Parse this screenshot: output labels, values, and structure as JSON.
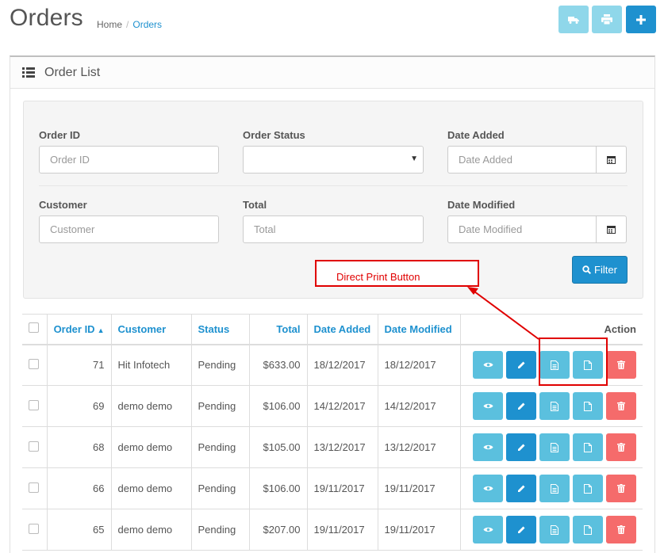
{
  "header": {
    "title": "Orders",
    "breadcrumb": [
      "Home",
      "Orders"
    ],
    "buttons": {
      "ship_icon": "truck-icon",
      "print_icon": "print-icon",
      "add_icon": "plus-icon"
    }
  },
  "panel": {
    "title": "Order List",
    "filters": {
      "order_id": {
        "label": "Order ID",
        "placeholder": "Order ID"
      },
      "order_status": {
        "label": "Order Status",
        "value": ""
      },
      "date_added": {
        "label": "Date Added",
        "placeholder": "Date Added"
      },
      "customer": {
        "label": "Customer",
        "placeholder": "Customer"
      },
      "total": {
        "label": "Total",
        "placeholder": "Total"
      },
      "date_modified": {
        "label": "Date Modified",
        "placeholder": "Date Modified"
      },
      "filter_button": "Filter"
    }
  },
  "annotation": {
    "label": "Direct Print Button",
    "color": "#e00000"
  },
  "table": {
    "columns": [
      "Order ID",
      "Customer",
      "Status",
      "Total",
      "Date Added",
      "Date Modified",
      "Action"
    ],
    "rows": [
      {
        "id": "71",
        "customer": "Hit Infotech",
        "status": "Pending",
        "total": "$633.00",
        "added": "18/12/2017",
        "modified": "18/12/2017"
      },
      {
        "id": "69",
        "customer": "demo demo",
        "status": "Pending",
        "total": "$106.00",
        "added": "14/12/2017",
        "modified": "14/12/2017"
      },
      {
        "id": "68",
        "customer": "demo demo",
        "status": "Pending",
        "total": "$105.00",
        "added": "13/12/2017",
        "modified": "13/12/2017"
      },
      {
        "id": "66",
        "customer": "demo demo",
        "status": "Pending",
        "total": "$106.00",
        "added": "19/11/2017",
        "modified": "19/11/2017"
      },
      {
        "id": "65",
        "customer": "demo demo",
        "status": "Pending",
        "total": "$207.00",
        "added": "19/11/2017",
        "modified": "19/11/2017"
      }
    ]
  },
  "colors": {
    "primary": "#1e91cf",
    "info": "#5bc0de",
    "info_light": "#8fd7ea",
    "danger": "#f56b6b"
  }
}
